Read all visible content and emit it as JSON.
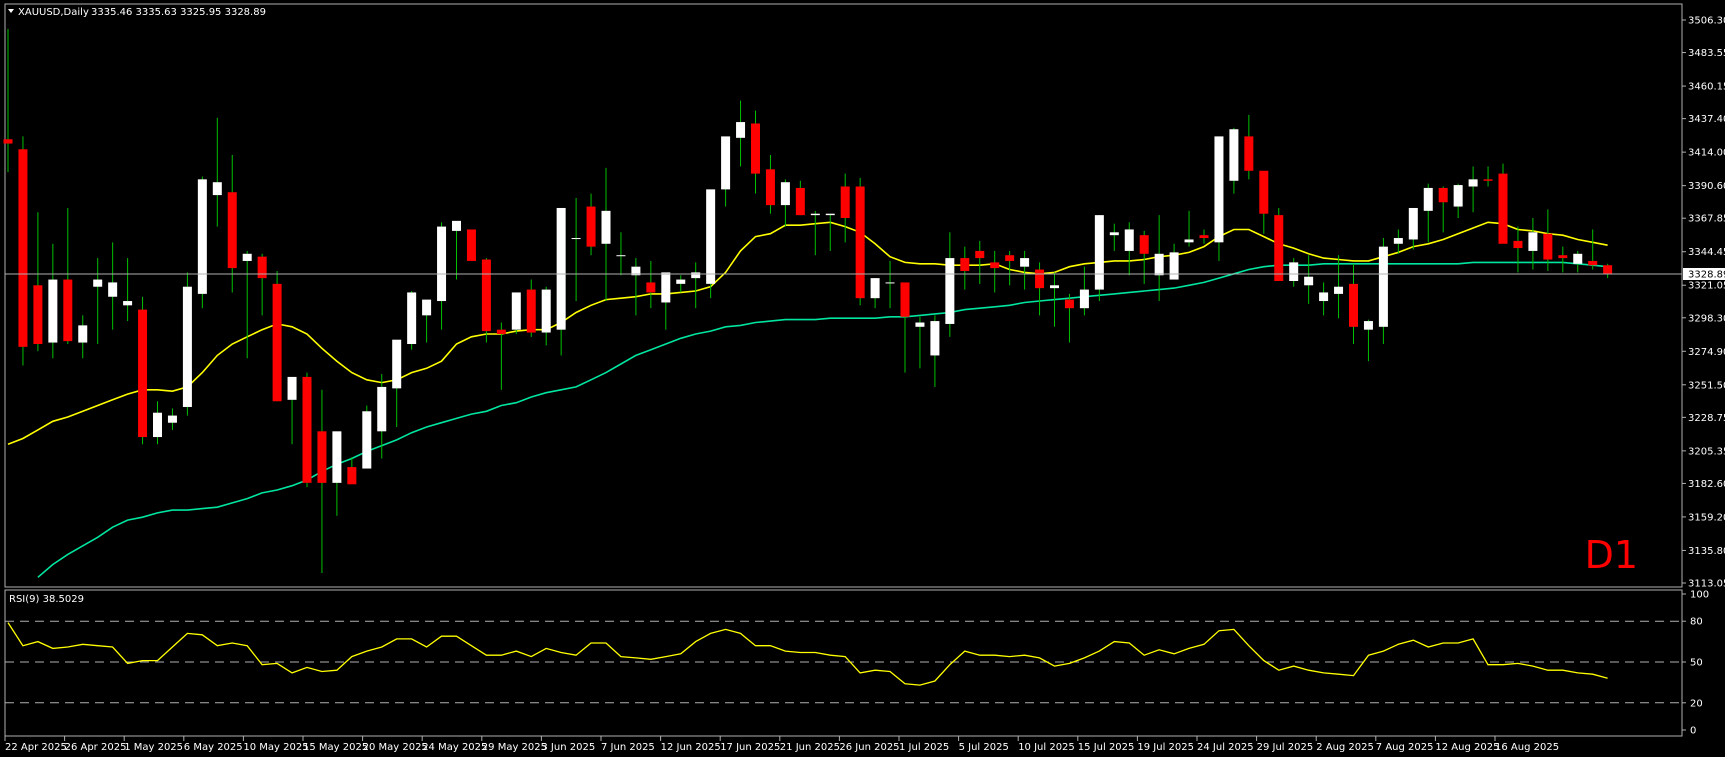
{
  "header": {
    "symbol": "XAUUSD,Daily",
    "ohlc": "3335.46 3335.63 3325.95 3328.89"
  },
  "timeframe_label": "D1",
  "indicator_label": "RSI(9) 38.5029",
  "colors": {
    "background": "#000000",
    "bull": "#ffffff",
    "bear": "#ff0000",
    "wick": "#00c000",
    "ma_fast": "#ffff00",
    "ma_slow": "#00e5a0",
    "rsi": "#ffff00",
    "grid": "#b0b0b0"
  },
  "chart_data": [
    {
      "type": "candlestick",
      "ylim": [
        3113.05,
        3506.3
      ],
      "price_ticks": [
        "3506.30",
        "3483.55",
        "3460.15",
        "3437.40",
        "3414.00",
        "3390.60",
        "3367.85",
        "3344.45",
        "3321.05",
        "3298.30",
        "3274.90",
        "3251.50",
        "3228.75",
        "3205.35",
        "3182.60",
        "3159.20",
        "3135.80",
        "3113.05"
      ],
      "current_price": "3328.89",
      "date_ticks": [
        "22 Apr 2025",
        "26 Apr 2025",
        "1 May 2025",
        "6 May 2025",
        "10 May 2025",
        "15 May 2025",
        "20 May 2025",
        "24 May 2025",
        "29 May 2025",
        "3 Jun 2025",
        "7 Jun 2025",
        "12 Jun 2025",
        "17 Jun 2025",
        "21 Jun 2025",
        "26 Jun 2025",
        "1 Jul 2025",
        "5 Jul 2025",
        "10 Jul 2025",
        "15 Jul 2025",
        "19 Jul 2025",
        "24 Jul 2025",
        "29 Jul 2025",
        "2 Aug 2025",
        "7 Aug 2025",
        "12 Aug 2025",
        "16 Aug 2025"
      ],
      "ohlc": [
        [
          3423,
          3500,
          3400,
          3420
        ],
        [
          3416,
          3425,
          3265,
          3278
        ],
        [
          3321,
          3372,
          3275,
          3280
        ],
        [
          3281,
          3350,
          3270,
          3325
        ],
        [
          3325,
          3375,
          3280,
          3282
        ],
        [
          3281,
          3300,
          3270,
          3293
        ],
        [
          3320,
          3340,
          3280,
          3325
        ],
        [
          3313,
          3351,
          3290,
          3323
        ],
        [
          3307,
          3340,
          3296,
          3310
        ],
        [
          3304,
          3313,
          3210,
          3215
        ],
        [
          3215,
          3240,
          3210,
          3232
        ],
        [
          3225,
          3235,
          3220,
          3230
        ],
        [
          3236,
          3330,
          3230,
          3320
        ],
        [
          3315,
          3397,
          3305,
          3395
        ],
        [
          3384,
          3438,
          3362,
          3393
        ],
        [
          3386,
          3412,
          3316,
          3333
        ],
        [
          3338,
          3345,
          3270,
          3343
        ],
        [
          3341,
          3343,
          3300,
          3326
        ],
        [
          3322,
          3331,
          3240,
          3240
        ],
        [
          3241,
          3243,
          3210,
          3257
        ],
        [
          3257,
          3260,
          3180,
          3183
        ],
        [
          3219,
          3248,
          3120,
          3183
        ],
        [
          3183,
          3210,
          3160,
          3219
        ],
        [
          3194,
          3201,
          3190,
          3182
        ],
        [
          3193,
          3237,
          3193,
          3233
        ],
        [
          3219,
          3259,
          3200,
          3250
        ],
        [
          3249,
          3281,
          3222,
          3283
        ],
        [
          3280,
          3317,
          3276,
          3316
        ],
        [
          3300,
          3302,
          3281,
          3311
        ],
        [
          3310,
          3365,
          3290,
          3362
        ],
        [
          3359,
          3365,
          3325,
          3366
        ],
        [
          3360,
          3358,
          3339,
          3338
        ],
        [
          3339,
          3340,
          3281,
          3289
        ],
        [
          3290,
          3295,
          3248,
          3287
        ],
        [
          3290,
          3316,
          3287,
          3316
        ],
        [
          3318,
          3325,
          3285,
          3288
        ],
        [
          3288,
          3320,
          3279,
          3318
        ],
        [
          3290,
          3296,
          3272,
          3375
        ],
        [
          3354,
          3382,
          3310,
          3354
        ],
        [
          3376,
          3385,
          3342,
          3348
        ],
        [
          3350,
          3403,
          3310,
          3373
        ],
        [
          3342,
          3358,
          3328,
          3342
        ],
        [
          3328,
          3340,
          3300,
          3334
        ],
        [
          3323,
          3338,
          3305,
          3316
        ],
        [
          3309,
          3320,
          3290,
          3330
        ],
        [
          3322,
          3328,
          3316,
          3325
        ],
        [
          3326,
          3337,
          3305,
          3330
        ],
        [
          3322,
          3334,
          3312,
          3388
        ],
        [
          3388,
          3410,
          3376,
          3425
        ],
        [
          3424,
          3450,
          3404,
          3435
        ],
        [
          3434,
          3443,
          3385,
          3399
        ],
        [
          3402,
          3412,
          3371,
          3377
        ],
        [
          3377,
          3395,
          3362,
          3393
        ],
        [
          3389,
          3394,
          3370,
          3370
        ],
        [
          3370,
          3373,
          3342,
          3371
        ],
        [
          3370,
          3371,
          3345,
          3371
        ],
        [
          3390,
          3399,
          3351,
          3368
        ],
        [
          3390,
          3396,
          3307,
          3312
        ],
        [
          3312,
          3326,
          3305,
          3326
        ],
        [
          3323,
          3338,
          3305,
          3323
        ],
        [
          3323,
          3318,
          3260,
          3299
        ],
        [
          3292,
          3299,
          3263,
          3295
        ],
        [
          3272,
          3300,
          3250,
          3296
        ],
        [
          3294,
          3358,
          3285,
          3340
        ],
        [
          3340,
          3348,
          3318,
          3331
        ],
        [
          3345,
          3352,
          3322,
          3340
        ],
        [
          3337,
          3345,
          3316,
          3333
        ],
        [
          3342,
          3345,
          3321,
          3338
        ],
        [
          3334,
          3345,
          3318,
          3340
        ],
        [
          3332,
          3337,
          3300,
          3319
        ],
        [
          3319,
          3330,
          3292,
          3321
        ],
        [
          3311,
          3315,
          3281,
          3305
        ],
        [
          3305,
          3334,
          3300,
          3318
        ],
        [
          3318,
          3370,
          3310,
          3370
        ],
        [
          3356,
          3364,
          3345,
          3358
        ],
        [
          3345,
          3365,
          3328,
          3360
        ],
        [
          3356,
          3359,
          3322,
          3343
        ],
        [
          3328,
          3370,
          3310,
          3343
        ],
        [
          3325,
          3350,
          3330,
          3344
        ],
        [
          3351,
          3373,
          3348,
          3353
        ],
        [
          3356,
          3360,
          3350,
          3354
        ],
        [
          3351,
          3389,
          3338,
          3425
        ],
        [
          3394,
          3431,
          3385,
          3430
        ],
        [
          3425,
          3440,
          3395,
          3401
        ],
        [
          3401,
          3398,
          3357,
          3371
        ],
        [
          3370,
          3375,
          3324,
          3324
        ],
        [
          3324,
          3340,
          3320,
          3337
        ],
        [
          3321,
          3342,
          3308,
          3327
        ],
        [
          3310,
          3323,
          3300,
          3316
        ],
        [
          3315,
          3342,
          3298,
          3320
        ],
        [
          3322,
          3336,
          3280,
          3292
        ],
        [
          3290,
          3297,
          3268,
          3296
        ],
        [
          3292,
          3354,
          3280,
          3348
        ],
        [
          3350,
          3360,
          3343,
          3354
        ],
        [
          3353,
          3372,
          3346,
          3375
        ],
        [
          3373,
          3392,
          3351,
          3389
        ],
        [
          3389,
          3390,
          3358,
          3379
        ],
        [
          3376,
          3392,
          3368,
          3391
        ],
        [
          3390,
          3404,
          3372,
          3395
        ],
        [
          3395,
          3404,
          3390,
          3394
        ],
        [
          3399,
          3406,
          3365,
          3350
        ],
        [
          3352,
          3362,
          3330,
          3347
        ],
        [
          3345,
          3368,
          3332,
          3358
        ],
        [
          3357,
          3374,
          3331,
          3339
        ],
        [
          3342,
          3348,
          3330,
          3340
        ],
        [
          3336,
          3345,
          3330,
          3343
        ],
        [
          3338,
          3360,
          3332,
          3335
        ],
        [
          3335,
          3336,
          3326,
          3329
        ]
      ],
      "series": [
        {
          "name": "MA fast",
          "values": [
            3210,
            3214,
            3220,
            3226,
            3229,
            3233,
            3237,
            3241,
            3245,
            3248,
            3248,
            3247,
            3250,
            3260,
            3272,
            3280,
            3285,
            3290,
            3294,
            3292,
            3287,
            3277,
            3268,
            3260,
            3255,
            3253,
            3255,
            3260,
            3263,
            3268,
            3280,
            3285,
            3287,
            3287,
            3289,
            3290,
            3290,
            3295,
            3302,
            3307,
            3311,
            3312,
            3313,
            3315,
            3315,
            3316,
            3317,
            3320,
            3330,
            3345,
            3355,
            3357,
            3363,
            3363,
            3364,
            3365,
            3362,
            3358,
            3350,
            3341,
            3337,
            3336,
            3336,
            3335,
            3335,
            3335,
            3336,
            3332,
            3330,
            3329,
            3330,
            3334,
            3336,
            3337,
            3338,
            3338,
            3339,
            3341,
            3342,
            3344,
            3348,
            3355,
            3360,
            3360,
            3355,
            3350,
            3347,
            3343,
            3340,
            3339,
            3338,
            3338,
            3341,
            3344,
            3348,
            3350,
            3353,
            3357,
            3361,
            3365,
            3364,
            3360,
            3359,
            3357,
            3356,
            3353,
            3351,
            3349
          ]
        },
        {
          "name": "MA slow",
          "values": [
            3105,
            3110,
            3117,
            3126,
            3133,
            3139,
            3145,
            3152,
            3157,
            3159,
            3162,
            3164,
            3164,
            3165,
            3166,
            3169,
            3172,
            3176,
            3178,
            3181,
            3185,
            3191,
            3196,
            3200,
            3205,
            3209,
            3213,
            3218,
            3222,
            3225,
            3228,
            3231,
            3233,
            3237,
            3239,
            3243,
            3246,
            3248,
            3250,
            3255,
            3260,
            3266,
            3272,
            3276,
            3280,
            3284,
            3287,
            3289,
            3292,
            3293,
            3295,
            3296,
            3297,
            3297,
            3297,
            3298,
            3298,
            3298,
            3298,
            3299,
            3299,
            3300,
            3301,
            3302,
            3304,
            3305,
            3306,
            3307,
            3309,
            3310,
            3311,
            3312,
            3313,
            3314,
            3315,
            3316,
            3317,
            3318,
            3319,
            3321,
            3323,
            3326,
            3329,
            3332,
            3334,
            3335,
            3335,
            3335,
            3336,
            3336,
            3336,
            3336,
            3336,
            3336,
            3336,
            3336,
            3336,
            3336,
            3337,
            3337,
            3337,
            3337,
            3337,
            3337,
            3337,
            3336,
            3335,
            3334
          ]
        }
      ]
    },
    {
      "type": "line",
      "title": "RSI(9) 38.5029",
      "ylim": [
        0,
        100
      ],
      "y_ticks": [
        "100",
        "80",
        "50",
        "20",
        "0"
      ],
      "levels": [
        20,
        50,
        80
      ],
      "series": [
        {
          "name": "RSI(9)",
          "values": [
            79,
            62,
            65,
            60,
            61,
            63,
            62,
            61,
            49,
            51,
            51,
            61,
            71,
            70,
            62,
            64,
            62,
            48,
            49,
            42,
            46,
            43,
            44,
            54,
            58,
            61,
            67,
            67,
            61,
            69,
            69,
            62,
            55,
            55,
            58,
            54,
            60,
            57,
            55,
            64,
            64,
            54,
            53,
            52,
            54,
            56,
            65,
            71,
            74,
            71,
            62,
            62,
            58,
            57,
            57,
            55,
            54,
            42,
            44,
            43,
            34,
            33,
            36,
            48,
            58,
            55,
            55,
            54,
            55,
            53,
            47,
            49,
            53,
            58,
            65,
            64,
            55,
            59,
            56,
            60,
            63,
            73,
            74,
            62,
            51,
            44,
            47,
            44,
            42,
            41,
            40,
            55,
            58,
            63,
            66,
            61,
            64,
            64,
            67,
            48,
            48,
            49,
            47,
            44,
            44,
            42,
            41,
            38
          ]
        }
      ]
    }
  ]
}
